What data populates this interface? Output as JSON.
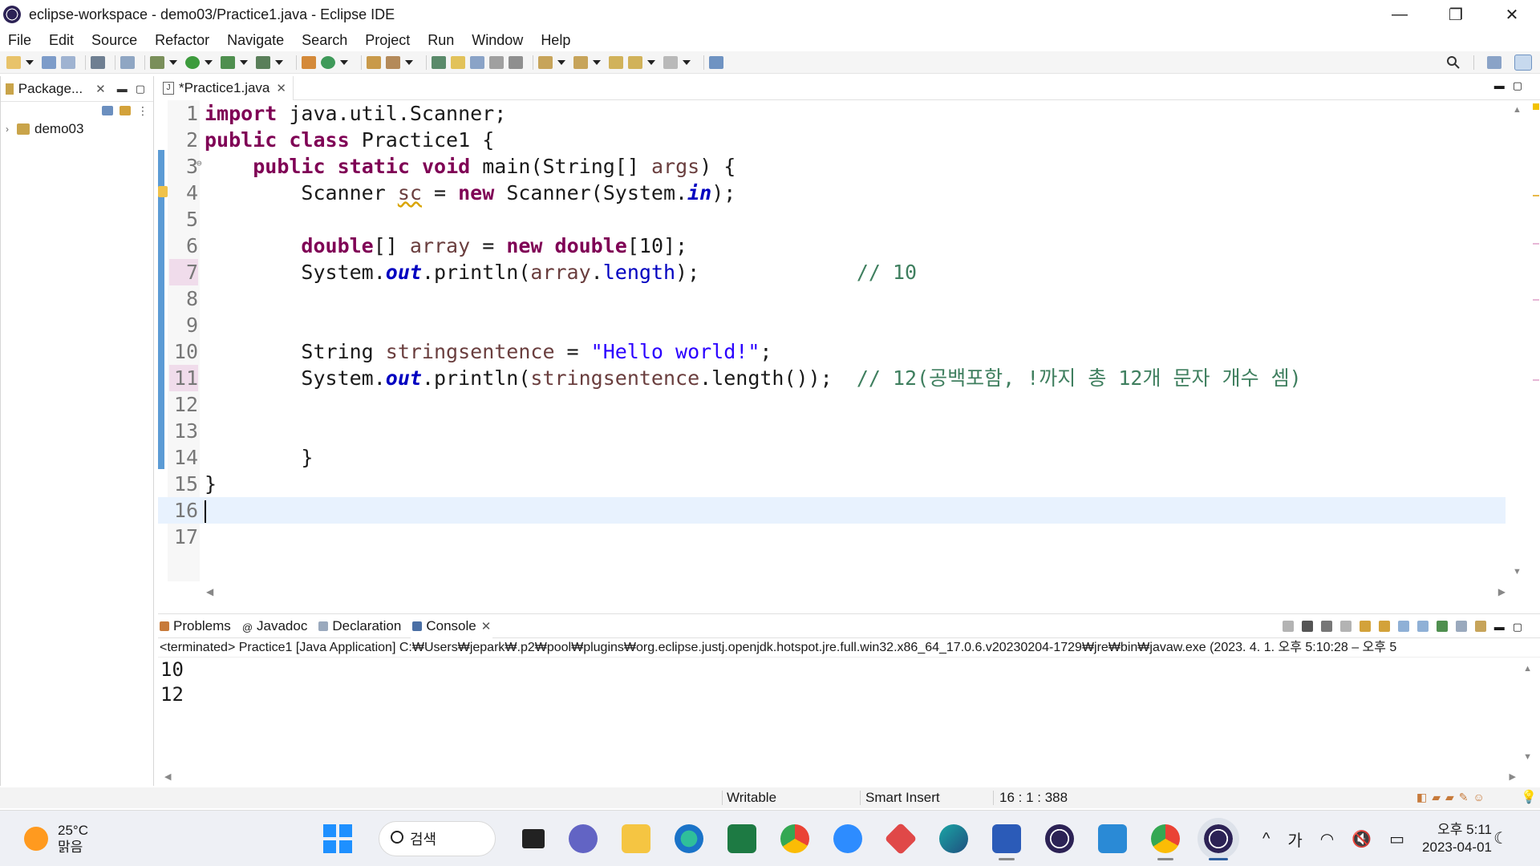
{
  "window": {
    "title": "eclipse-workspace - demo03/Practice1.java - Eclipse IDE",
    "controls": [
      "—",
      "❐",
      "✕"
    ]
  },
  "menu": [
    "File",
    "Edit",
    "Source",
    "Refactor",
    "Navigate",
    "Search",
    "Project",
    "Run",
    "Window",
    "Help"
  ],
  "package_explorer": {
    "tab_label": "Package...",
    "project": "demo03"
  },
  "editor": {
    "tab_label": "*Practice1.java",
    "lines": [
      {
        "n": "1"
      },
      {
        "n": "2"
      },
      {
        "n": "3"
      },
      {
        "n": "4"
      },
      {
        "n": "5"
      },
      {
        "n": "6"
      },
      {
        "n": "7"
      },
      {
        "n": "8"
      },
      {
        "n": "9"
      },
      {
        "n": "10"
      },
      {
        "n": "11"
      },
      {
        "n": "12"
      },
      {
        "n": "13"
      },
      {
        "n": "14"
      },
      {
        "n": "15"
      },
      {
        "n": "16"
      },
      {
        "n": "17"
      }
    ],
    "code": {
      "l1_kw": "import",
      "l1_rest": " java.util.Scanner;",
      "l2_kw1": "public",
      "l2_kw2": "class",
      "l2_rest": " Practice1 {",
      "l3_kw1": "public",
      "l3_kw2": "static",
      "l3_kw3": "void",
      "l3_rest": " main(String[] ",
      "l3_arg": "args",
      "l3_end": ") {",
      "l4_a": "Scanner ",
      "l4_var": "sc",
      "l4_b": " = ",
      "l4_kw": "new",
      "l4_c": " Scanner(System.",
      "l4_fld": "in",
      "l4_d": ");",
      "l6_kw1": "double",
      "l6_a": "[] ",
      "l6_var": "array",
      "l6_b": " = ",
      "l6_kw2": "new",
      "l6_kw3": "double",
      "l6_c": "[10];",
      "l7_a": "System.",
      "l7_fld": "out",
      "l7_b": ".println(",
      "l7_var": "array",
      "l7_c": ".",
      "l7_len": "length",
      "l7_d": ");",
      "l7_cmt": "// 10",
      "l10_a": "String ",
      "l10_var": "stringsentence",
      "l10_b": " = ",
      "l10_str": "\"Hello world!\"",
      "l10_c": ";",
      "l11_a": "System.",
      "l11_fld": "out",
      "l11_b": ".println(",
      "l11_var": "stringsentence",
      "l11_c": ".length());",
      "l11_cmt": "// 12(공백포함, !까지 총 12개 문자 개수 셈)",
      "l14": "}",
      "l15": "}"
    }
  },
  "console": {
    "tabs": [
      "Problems",
      "Javadoc",
      "Declaration",
      "Console"
    ],
    "header": "<terminated> Practice1 [Java Application] C:₩Users₩jepark₩.p2₩pool₩plugins₩org.eclipse.justj.openjdk.hotspot.jre.full.win32.x86_64_17.0.6.v20230204-1729₩jre₩bin₩javaw.exe  (2023. 4. 1. 오후 5:10:28 – 오후 5",
    "output": [
      "10",
      "12"
    ]
  },
  "status": {
    "writable": "Writable",
    "insert_mode": "Smart Insert",
    "position": "16 : 1 : 388"
  },
  "taskbar": {
    "temperature": "25°C",
    "weather": "맑음",
    "search": "검색",
    "ime": "가",
    "time": "오후 5:11",
    "date": "2023-04-01"
  },
  "colors": {
    "keyword": "#7f0055",
    "string": "#2a00ff",
    "comment": "#3f7f5f",
    "field": "#0000c0",
    "local_var": "#6a3e3e",
    "current_line": "#e8f2fe",
    "change_bar": "#5b9bd5"
  }
}
